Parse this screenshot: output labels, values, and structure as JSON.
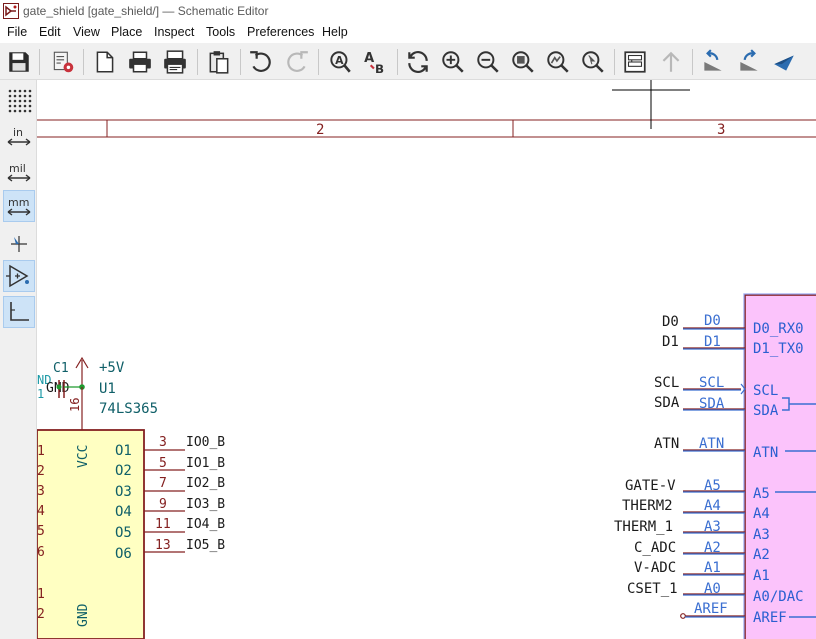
{
  "window": {
    "title": "gate_shield [gate_shield/] — Schematic Editor"
  },
  "menu": [
    "File",
    "Edit",
    "View",
    "Place",
    "Inspect",
    "Tools",
    "Preferences",
    "Help"
  ],
  "toolbar_icons": [
    "save-icon",
    "schematic-setup-icon",
    "page-settings-icon",
    "print-icon",
    "plot-icon",
    "paste-icon",
    "undo-icon",
    "redo-icon",
    "find-icon",
    "find-replace-icon",
    "refresh-icon",
    "zoom-in-icon",
    "zoom-out-icon",
    "zoom-fit-icon",
    "zoom-objects-icon",
    "zoom-selection-icon",
    "hierarchy-navigator-icon",
    "leave-sheet-icon",
    "rotate-ccw-icon",
    "rotate-cw-icon",
    "mirror-icon"
  ],
  "left_toolbar": {
    "units": {
      "in": "in",
      "mil": "mil",
      "mm": "mm"
    },
    "active_unit": "mm"
  },
  "schematic": {
    "border_columns": [
      "2",
      "3"
    ],
    "u1": {
      "ref": "U1",
      "value": "74LS365",
      "power": "+5V",
      "pin_vcc": "VCC",
      "pin_gnd": "GND",
      "pin_vcc_num": "16",
      "left_pin_nums": [
        "1",
        "2",
        "3",
        "4",
        "5",
        "6",
        "1",
        "2"
      ],
      "outputs": [
        {
          "name": "O1",
          "num": "3",
          "net": "IO0_B"
        },
        {
          "name": "O2",
          "num": "5",
          "net": "IO1_B"
        },
        {
          "name": "O3",
          "num": "7",
          "net": "IO2_B"
        },
        {
          "name": "O4",
          "num": "9",
          "net": "IO3_B"
        },
        {
          "name": "O5",
          "num": "11",
          "net": "IO4_B"
        },
        {
          "name": "O6",
          "num": "13",
          "net": "IO5_B"
        }
      ]
    },
    "c1": {
      "ref": "C1",
      "gnd": "GND"
    },
    "partial_left_texts": [
      "ND",
      "1"
    ],
    "arduino_nets": [
      {
        "signal": "D0",
        "label": "D0",
        "pin": "D0_RX0"
      },
      {
        "signal": "D1",
        "label": "D1",
        "pin": "D1_TX0"
      },
      {
        "signal": "SCL",
        "label": "SCL",
        "pin": "SCL"
      },
      {
        "signal": "SDA",
        "label": "SDA",
        "pin": "SDA"
      },
      {
        "signal": "ATN",
        "label": "ATN",
        "pin": "ATN"
      },
      {
        "signal": "GATE-V",
        "label": "A5",
        "pin": "A5"
      },
      {
        "signal": "THERM2",
        "label": "A4",
        "pin": "A4"
      },
      {
        "signal": "THERM_1",
        "label": "A3",
        "pin": "A3"
      },
      {
        "signal": "C_ADC",
        "label": "A2",
        "pin": "A2"
      },
      {
        "signal": "V-ADC",
        "label": "A1",
        "pin": "A1"
      },
      {
        "signal": "CSET_1",
        "label": "A0",
        "pin": "A0/DAC"
      },
      {
        "signal": "",
        "label": "AREF",
        "pin": "AREF"
      }
    ]
  }
}
